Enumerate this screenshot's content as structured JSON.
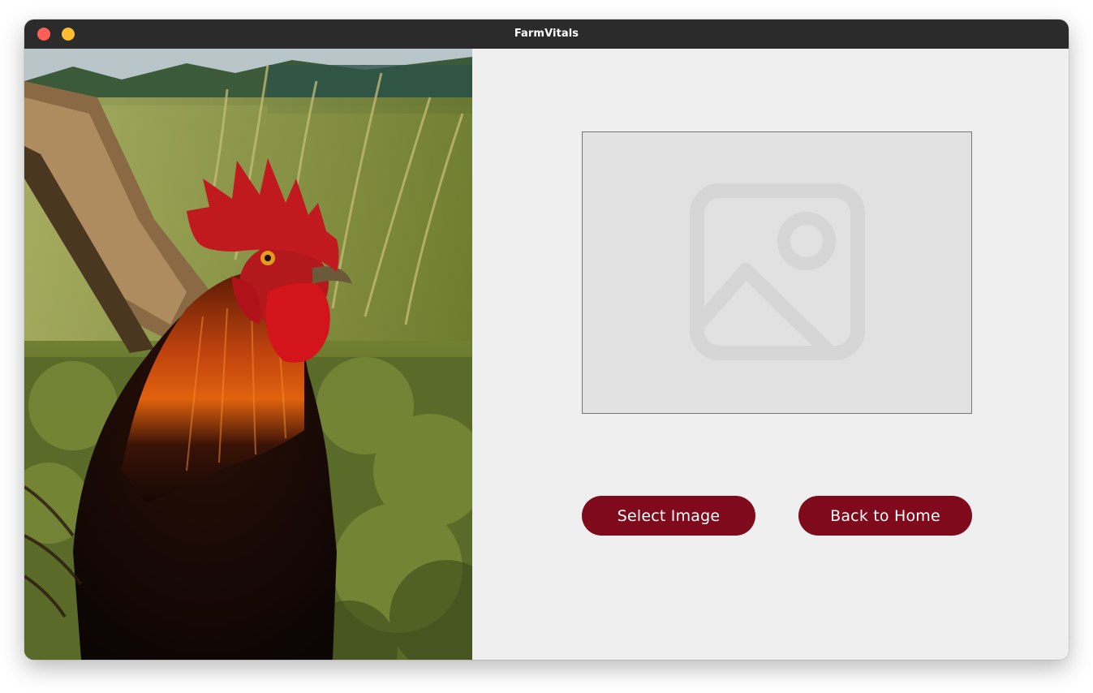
{
  "window": {
    "title": "FarmVitals"
  },
  "hero_image": {
    "subject": "rooster"
  },
  "preview": {
    "icon": "image-placeholder-icon"
  },
  "actions": {
    "select_image_label": "Select Image",
    "back_home_label": "Back to Home"
  },
  "colors": {
    "button_bg": "#7e0a1c",
    "button_text": "#ffffff",
    "content_bg": "#efefef",
    "preview_bg": "#e1e1e1",
    "titlebar_bg": "#2b2b2b"
  }
}
